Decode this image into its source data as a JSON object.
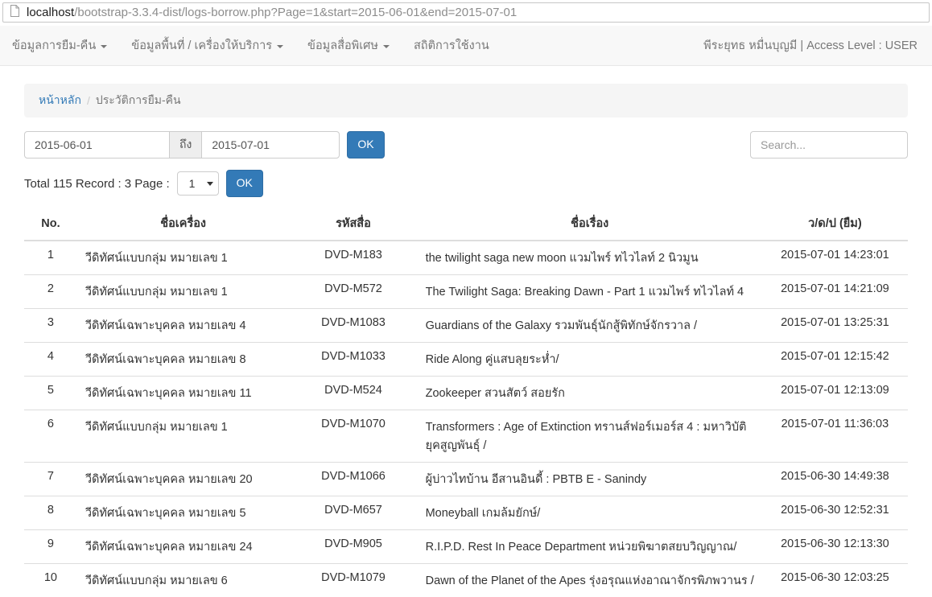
{
  "browser": {
    "url_host": "localhost",
    "url_path": "/bootstrap-3.3.4-dist/logs-borrow.php?Page=1&start=2015-06-01&end=2015-07-01"
  },
  "navbar": {
    "items": [
      {
        "label": "ข้อมูลการยืม-คืน",
        "dropdown": true
      },
      {
        "label": "ข้อมูลพื้นที่ / เครื่องให้บริการ",
        "dropdown": true
      },
      {
        "label": "ข้อมูลสื่อพิเศษ",
        "dropdown": true
      },
      {
        "label": "สถิติการใช้งาน",
        "dropdown": false
      }
    ],
    "user_info": "พีระยุทธ หมื่นบุญมี | Access Level : USER"
  },
  "breadcrumb": {
    "home": "หน้าหลัก",
    "current": "ประวัติการยืม-คืน"
  },
  "filter": {
    "start_date": "2015-06-01",
    "to_label": "ถึง",
    "end_date": "2015-07-01",
    "ok_label": "OK",
    "search_placeholder": "Search..."
  },
  "pagination": {
    "summary": "Total 115 Record : 3 Page :",
    "selected_page": "1",
    "ok_label": "OK"
  },
  "table": {
    "headers": [
      "No.",
      "ชื่อเครื่อง",
      "รหัสสื่อ",
      "ชื่อเรื่อง",
      "ว/ด/ป (ยืม)"
    ],
    "rows": [
      [
        "1",
        "วีดิทัศน์แบบกลุ่ม หมายเลข 1",
        "DVD-M183",
        "the twilight saga new moon แวมไพร์ ทไวไลท์ 2 นิวมูน",
        "2015-07-01 14:23:01"
      ],
      [
        "2",
        "วีดิทัศน์แบบกลุ่ม หมายเลข 1",
        "DVD-M572",
        "The Twilight Saga: Breaking Dawn - Part 1 แวมไพร์ ทไวไลท์ 4",
        "2015-07-01 14:21:09"
      ],
      [
        "3",
        "วีดิทัศน์เฉพาะบุคคล หมายเลข 4",
        "DVD-M1083",
        "Guardians of the Galaxy รวมพันธุ์นักสู้พิทักษ์จักรวาล /",
        "2015-07-01 13:25:31"
      ],
      [
        "4",
        "วีดิทัศน์เฉพาะบุคคล หมายเลข 8",
        "DVD-M1033",
        "Ride Along คู่แสบลุยระห่ำ/",
        "2015-07-01 12:15:42"
      ],
      [
        "5",
        "วีดิทัศน์เฉพาะบุคคล หมายเลข 11",
        "DVD-M524",
        "Zookeeper สวนสัตว์ สอยรัก",
        "2015-07-01 12:13:09"
      ],
      [
        "6",
        "วีดิทัศน์แบบกลุ่ม หมายเลข 1",
        "DVD-M1070",
        "Transformers : Age of Extinction ทรานส์ฟอร์เมอร์ส 4 : มหาวิบัติยุคสูญพันธุ์ /",
        "2015-07-01 11:36:03"
      ],
      [
        "7",
        "วีดิทัศน์เฉพาะบุคคล หมายเลข 20",
        "DVD-M1066",
        "ผู้บ่าวไทบ้าน อีสานอินดี้ : PBTB E - Sanindy",
        "2015-06-30 14:49:38"
      ],
      [
        "8",
        "วีดิทัศน์เฉพาะบุคคล หมายเลข 5",
        "DVD-M657",
        "Moneyball เกมล้มยักษ์/",
        "2015-06-30 12:52:31"
      ],
      [
        "9",
        "วีดิทัศน์เฉพาะบุคคล หมายเลข 24",
        "DVD-M905",
        "R.I.P.D. Rest In Peace Department หน่วยพิฆาตสยบวิญญาณ/",
        "2015-06-30 12:13:30"
      ],
      [
        "10",
        "วีดิทัศน์แบบกลุ่ม หมายเลข 6",
        "DVD-M1079",
        "Dawn of the Planet of the Apes รุ่งอรุณแห่งอาณาจักรพิภพวานร /",
        "2015-06-30 12:03:25"
      ]
    ]
  },
  "colors": {
    "primary": "#337ab7",
    "primary_border": "#2e6da4",
    "navbar_bg": "#f8f8f8",
    "breadcrumb_bg": "#f5f5f5",
    "table_border": "#dddddd",
    "nav_text": "#777777"
  }
}
